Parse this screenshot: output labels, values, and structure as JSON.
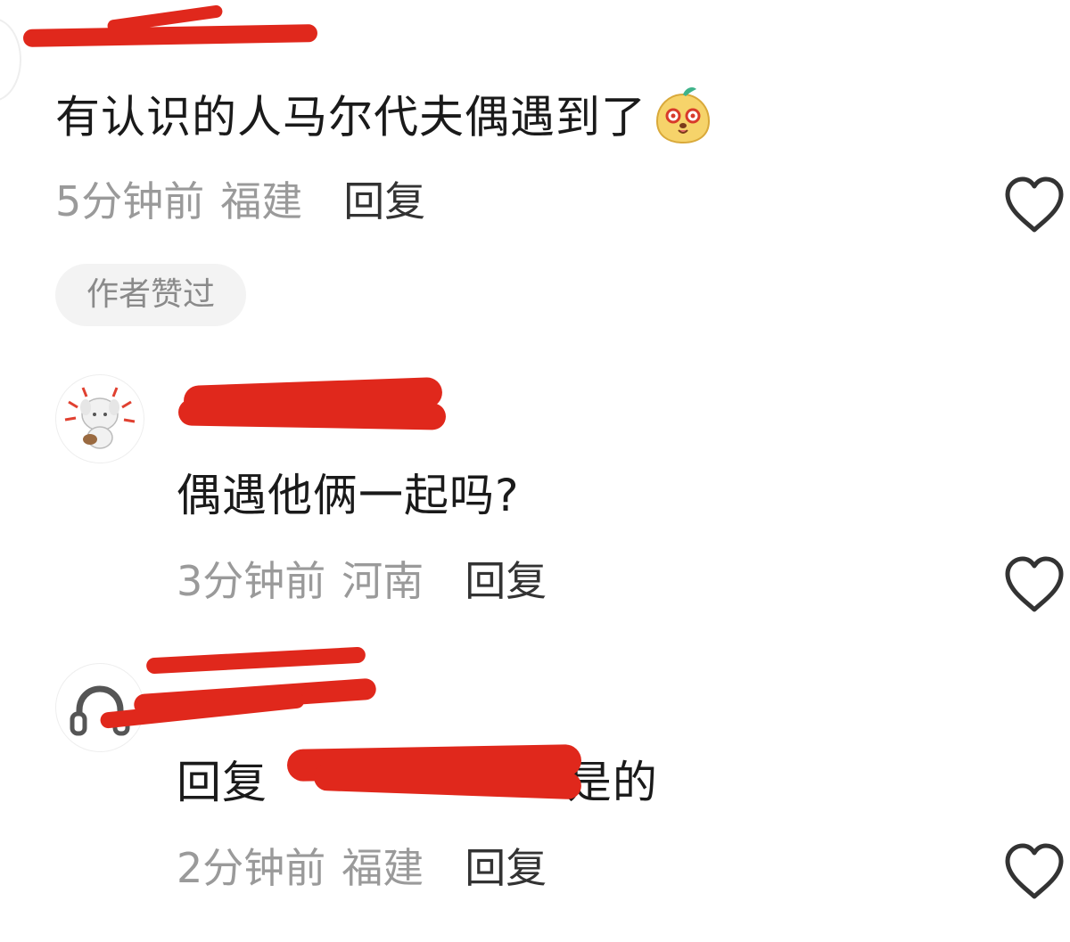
{
  "comments": [
    {
      "text": "有认识的人马尔代夫偶遇到了",
      "time": "5分钟前",
      "region": "福建",
      "reply_label": "回复",
      "badge": "作者赞过"
    }
  ],
  "replies": [
    {
      "text": "偶遇他俩一起吗?",
      "time": "3分钟前",
      "region": "河南",
      "reply_label": "回复"
    },
    {
      "prefix": "回复",
      "text": ":是的",
      "time": "2分钟前",
      "region": "福建",
      "reply_label": "回复"
    }
  ],
  "icons": {
    "like": "heart-outline-icon",
    "sticker": "smiling-face-sticker-icon",
    "avatar_1": "cartoon-dog-avatar-icon",
    "avatar_2": "headphones-avatar-icon"
  },
  "colors": {
    "redaction": "#e0281c",
    "meta_gray": "#9a9a9a",
    "text_dark": "#1a1a1a"
  }
}
